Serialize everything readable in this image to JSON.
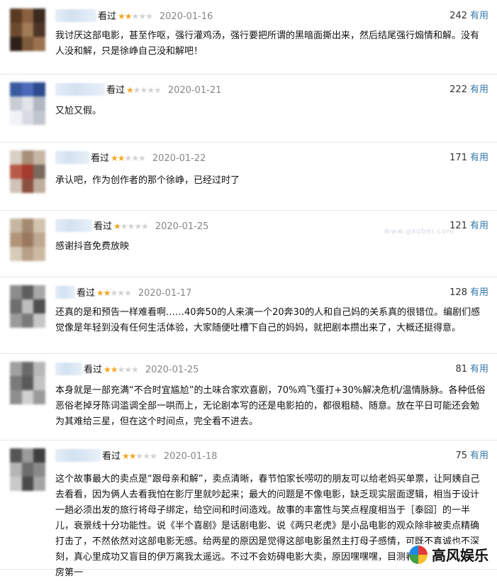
{
  "reviews": [
    {
      "seen_label": "看过",
      "rating": 2,
      "date": "2020-01-16",
      "votes": "242",
      "useful_label": "有用",
      "text": "我讨厌这部电影，甚至作呕，强行灌鸡汤，强行要把所谓的黑暗面撕出来，然后结尾强行煽情和解。没有人没和解，只是徐峥自己没和解吧！",
      "avatar_colors": [
        "#5a3a22",
        "#8a6040",
        "#3c2a1e",
        "#6b4a30",
        "#a07b55",
        "#4d3426",
        "#2e2018",
        "#7d5a3c",
        "#9a7250"
      ]
    },
    {
      "seen_label": "看过",
      "rating": 1,
      "date": "2020-01-21",
      "votes": "222",
      "useful_label": "有用",
      "text": "又尬又假。",
      "avatar_colors": [
        "#3a5aa0",
        "#4a6ab8",
        "#2e4a90",
        "#c8ccd4",
        "#e0e3e8",
        "#b0b6c2",
        "#f0f2f5",
        "#d8dce2",
        "#c0c5ce"
      ]
    },
    {
      "seen_label": "看过",
      "rating": 2,
      "date": "2020-01-22",
      "votes": "171",
      "useful_label": "有用",
      "text": "承认吧，作为创作者的那个徐峥，已经过时了",
      "avatar_colors": [
        "#d9cfc4",
        "#a88f7a",
        "#c8b6a4",
        "#b85a48",
        "#a63a2e",
        "#7a6a5e",
        "#d0c4b8",
        "#8a5040",
        "#bfae9c"
      ]
    },
    {
      "seen_label": "看过",
      "rating": 1,
      "date": "2020-01-25",
      "votes": "121",
      "useful_label": "有用",
      "text": "感谢抖音免费放映",
      "avatar_colors": [
        "#c7b7a2",
        "#a48a70",
        "#d2c3ae",
        "#b29478",
        "#9a7860",
        "#c0a890",
        "#d8cbb8",
        "#b8a088",
        "#cbb9a2"
      ]
    },
    {
      "seen_label": "看过",
      "rating": 2,
      "date": "2020-01-17",
      "votes": "128",
      "useful_label": "有用",
      "text": "还真的是和预告一样难看啊……40奔50的人来演一个20奔30的人和自己妈的关系真的很错位。编剧们感觉像是年轻到没有任何生活体验，大家随便吐槽下自己的妈妈，就把剧本攒出来了，大概还挺得意。",
      "avatar_colors": [
        "#8c8c8c",
        "#5e5e5e",
        "#a8a8a8",
        "#6e6e6e",
        "#bdbdbd",
        "#4f4f4f",
        "#9a9a9a",
        "#7a7a7a",
        "#c6c6c6"
      ]
    },
    {
      "seen_label": "看过",
      "rating": 2,
      "date": "2020-01-25",
      "votes": "81",
      "useful_label": "有用",
      "text": "本身就是一部充满“不合时宜尴尬”的土味合家欢喜剧，70%鸡飞蛋打+30%解决危机/温情脉脉。各种低俗恶俗老掉牙陈词滥调全部一哄而上，无论剧本写的还是电影拍的，都很粗糙、随意。放在平日可能还会勉为其难给三星，但在这个时间点，完全看不进去。",
      "avatar_colors": [
        "#a0a0a0",
        "#6a6a6a",
        "#b8b8b8",
        "#7a7a7a",
        "#5a5a5a",
        "#c4c4c4",
        "#8e8e8e",
        "#d0d0d0",
        "#9a9a9a"
      ]
    },
    {
      "seen_label": "看过",
      "rating": 2,
      "date": "2020-01-18",
      "votes": "75",
      "useful_label": "有用",
      "text": "这个故事最大的卖点是“跟母亲和解”，卖点清晰，春节怕家长唠叨的朋友可以给老妈买单票，让阿姨自己去看看，因为俩人去看我怕在影厅里就吵起来；最大的问题是不像电影，缺乏现实层面逻辑，相当于设计一趟必须出发的旅行将母子绑定，给空间和时间造戏。故事的丰富性与笑点程度相当于［泰囧］的一半儿，衰景线十分功能性。说《半个喜剧》是话剧电影、说《两只老虎》是小品电影的观众除非被卖点精确打击了，不然依然对这部电影无感。给两星的原因是觉得这部电影虽然主打母子感情，可既不真诚也不深刻，真心里成功又盲目的伊万离我太遥远。不过不会妨碍电影大卖，原因嘿嘿嘿，目测春节档《囧妈》票房第一",
      "avatar_colors": [
        "#555555",
        "#9b9b9b",
        "#3f3f3f",
        "#b5b5b5",
        "#6c6c6c",
        "#8a8a8a",
        "#c9c9c9",
        "#4a4a4a",
        "#a5a5a5"
      ]
    }
  ],
  "watermark": {
    "brand": "高风娱乐",
    "url": "www.gaobei.com"
  }
}
